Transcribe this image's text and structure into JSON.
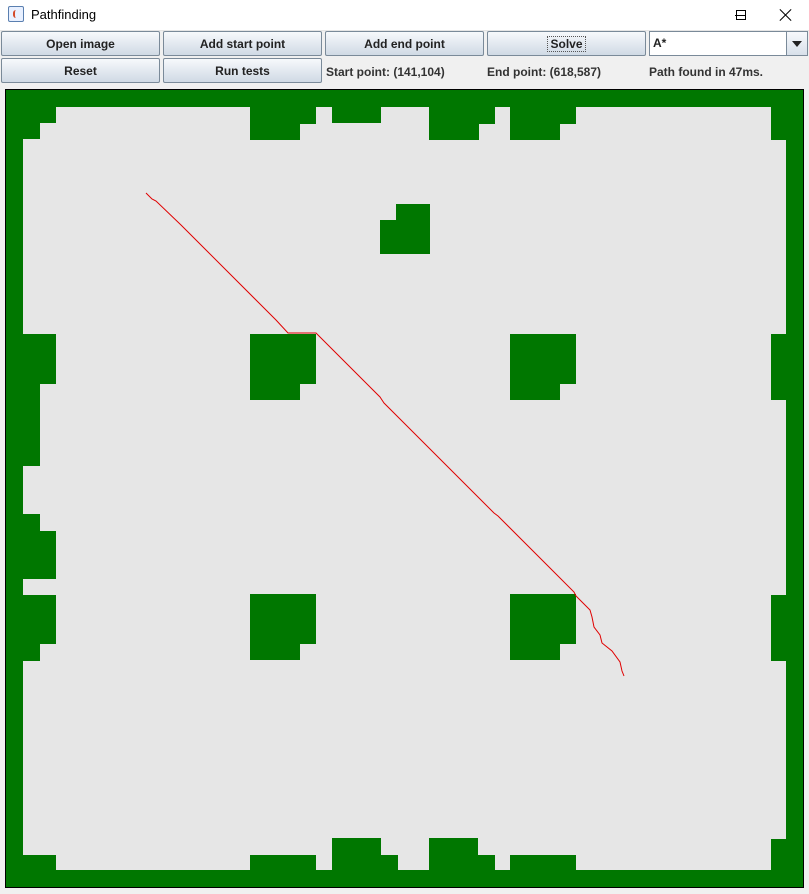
{
  "window": {
    "title": "Pathfinding"
  },
  "toolbar": {
    "open_image": "Open image",
    "add_start": "Add start point",
    "add_end": "Add end point",
    "solve": "Solve",
    "reset": "Reset",
    "run_tests": "Run tests",
    "algorithm": "A*"
  },
  "status": {
    "start_point": "Start point: (141,104)",
    "end_point": "End point: (618,587)",
    "result": "Path found in 47ms."
  },
  "colors": {
    "wall": "#007700",
    "floor": "#e6e6e6",
    "path": "#e00000"
  },
  "map": {
    "cell_size": 16,
    "grid_size": 49,
    "walls": [
      "wall-border",
      "wall-blocks"
    ]
  }
}
